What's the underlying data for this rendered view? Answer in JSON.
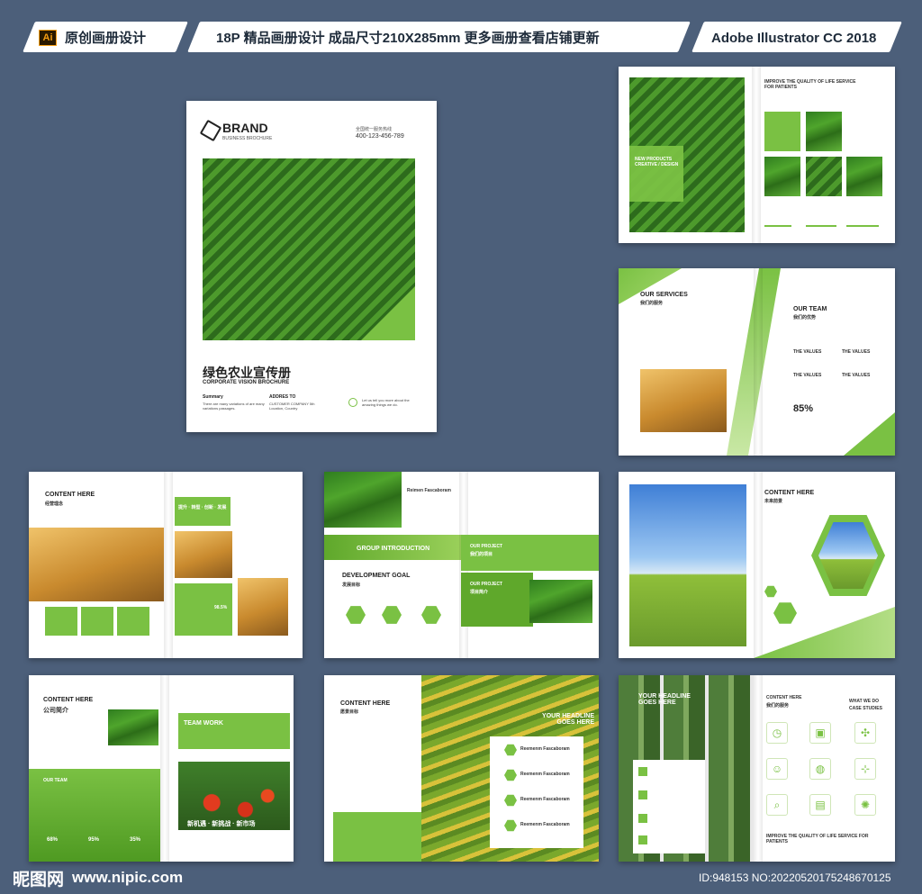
{
  "banner": {
    "ai_badge": "Ai",
    "left_label": "原创画册设计",
    "center_label": "18P 精品画册设计  成品尺寸210X285mm  更多画册查看店铺更新",
    "right_label": "Adobe Illustrator CC 2018"
  },
  "cover": {
    "brand": "BRAND",
    "brand_sub": "BUSINESS BROCHURE",
    "hotline_label": "全国统一服务热线",
    "hotline": "400-123-456-789",
    "title_cn": "绿色农业宣传册",
    "title_en": "CORPORATE VISION BROCHURE",
    "summary_label": "Summary",
    "summary_text": "There are many variations of   are many variations passages.",
    "address_label": "ADDRES TO",
    "address_text": "CUSTOMER COMPANY 5th Location, Country",
    "tagline": "Let us tell you more about the amazing things we do."
  },
  "spread1": {
    "headline": "IMPROVE THE QUALITY OF LIFE SERVICE FOR PATIENTS",
    "overlay": "NEW PRODUCTS CREATIVE / DESIGN"
  },
  "spread2": {
    "services_en": "OUR SERVICES",
    "services_cn": "我们的服务",
    "team_en": "OUR TEAM",
    "team_cn": "我们的优势",
    "values_1": "THE VALUES",
    "values_2": "THE VALUES",
    "values_3": "THE VALUES",
    "values_4": "THE VALUES",
    "percent": "85%"
  },
  "spread3": {
    "content_here": "CONTENT HERE",
    "philosophy_cn": "经营理念",
    "tags": "提升 · 转型 · 创新 · 发展",
    "percent": "98.5%"
  },
  "spread4": {
    "top_label": "Reimen Fascaboram",
    "group_intro": "GROUP INTRODUCTION",
    "dev_goal": "DEVELOPMENT GOAL",
    "dev_goal_cn": "发展目标",
    "project_1": "OUR PROJECT",
    "project_1_cn": "我们的项目",
    "project_2": "OUR PROJECT",
    "project_2_cn": "项目简介"
  },
  "spread5": {
    "content_here": "CONTENT HERE",
    "future_cn": "未来前景"
  },
  "spread6": {
    "content_here": "CONTENT HERE",
    "profile_cn": "公司简介",
    "our_team": "OUR TEAM",
    "team_work": "TEAM WORK",
    "slogan": "新机遇 · 新挑战 · 新市场",
    "stat_1": "68%",
    "stat_2": "95%",
    "stat_3": "35%"
  },
  "spread7": {
    "content_here": "CONTENT HERE",
    "vision_cn": "愿景目标",
    "headline": "YOUR HEADLINE GOES HERE",
    "item_label": "Reemenm Fascaboram"
  },
  "spread8": {
    "headline": "YOUR HEADLINE GOES HERE",
    "content_here": "CONTENT HERE",
    "services_cn": "我们的服务",
    "what_we_do": "WHAT WE DO",
    "case_studies": "CASE STUDIES",
    "bottom_headline": "IMPROVE THE QUALITY OF LIFE SERVICE FOR PATIENTS"
  },
  "footer": {
    "logo_cn": "昵图网",
    "site": "www.nipic.com",
    "id_text": "ID:948153 NO:20220520175248670125"
  },
  "colors": {
    "accent": "#7ac143",
    "background": "#4c5f7a"
  }
}
